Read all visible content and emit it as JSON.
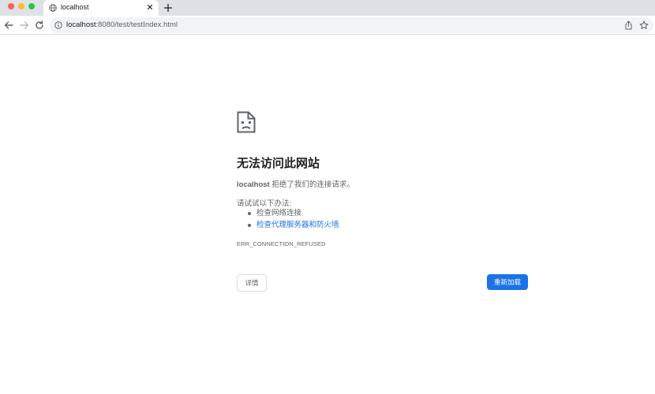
{
  "browser": {
    "tab": {
      "title": "localhost",
      "favicon": "globe-icon"
    },
    "new_tab_icon": "plus-icon",
    "url_host": "localhost",
    "url_rest": ":8080/test/testIndex.html",
    "nav_icons": [
      "arrow-left-icon",
      "arrow-right-icon",
      "reload-icon"
    ],
    "omnibox_icons": [
      "info-icon",
      "share-icon",
      "star-icon"
    ]
  },
  "error_page": {
    "icon": "sad-page-icon",
    "heading": "无法访问此网站",
    "host": "localhost",
    "desc_rest": " 拒绝了我们的连接请求。",
    "try_label": "请试试以下办法:",
    "suggestions": [
      "检查网络连接",
      "检查代理服务器和防火墙"
    ],
    "error_code": "ERR_CONNECTION_REFUSED",
    "details_label": "详情",
    "reload_label": "重新加载"
  },
  "colors": {
    "tab_strip_bg": "#dee1e6",
    "link": "#1a73e8",
    "button_primary": "#1a73e8",
    "text_secondary": "#5f6368"
  }
}
